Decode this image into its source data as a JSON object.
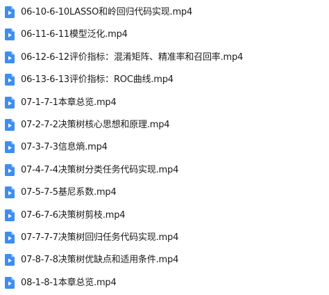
{
  "files": [
    {
      "name": "06-10-6-10LASSO和岭回归代码实现.mp4",
      "icon": "video-file-icon"
    },
    {
      "name": "06-11-6-11模型泛化.mp4",
      "icon": "video-file-icon"
    },
    {
      "name": "06-12-6-12评价指标：混淆矩阵、精准率和召回率.mp4",
      "icon": "video-file-icon"
    },
    {
      "name": "06-13-6-13评价指标：ROC曲线.mp4",
      "icon": "video-file-icon"
    },
    {
      "name": "07-1-7-1本章总览.mp4",
      "icon": "video-file-icon"
    },
    {
      "name": "07-2-7-2决策树核心思想和原理.mp4",
      "icon": "video-file-icon"
    },
    {
      "name": "07-3-7-3信息熵.mp4",
      "icon": "video-file-icon"
    },
    {
      "name": "07-4-7-4决策树分类任务代码实现.mp4",
      "icon": "video-file-icon"
    },
    {
      "name": "07-5-7-5基尼系数.mp4",
      "icon": "video-file-icon"
    },
    {
      "name": "07-6-7-6决策树剪枝.mp4",
      "icon": "video-file-icon"
    },
    {
      "name": "07-7-7-7决策树回归任务代码实现.mp4",
      "icon": "video-file-icon"
    },
    {
      "name": "07-8-7-8决策树优缺点和适用条件.mp4",
      "icon": "video-file-icon"
    },
    {
      "name": "08-1-8-1本章总览.mp4",
      "icon": "video-file-icon"
    }
  ],
  "colors": {
    "icon_blue": "#3d8ef0",
    "icon_fold": "#a9cdf8",
    "text": "#1a1a1a"
  }
}
